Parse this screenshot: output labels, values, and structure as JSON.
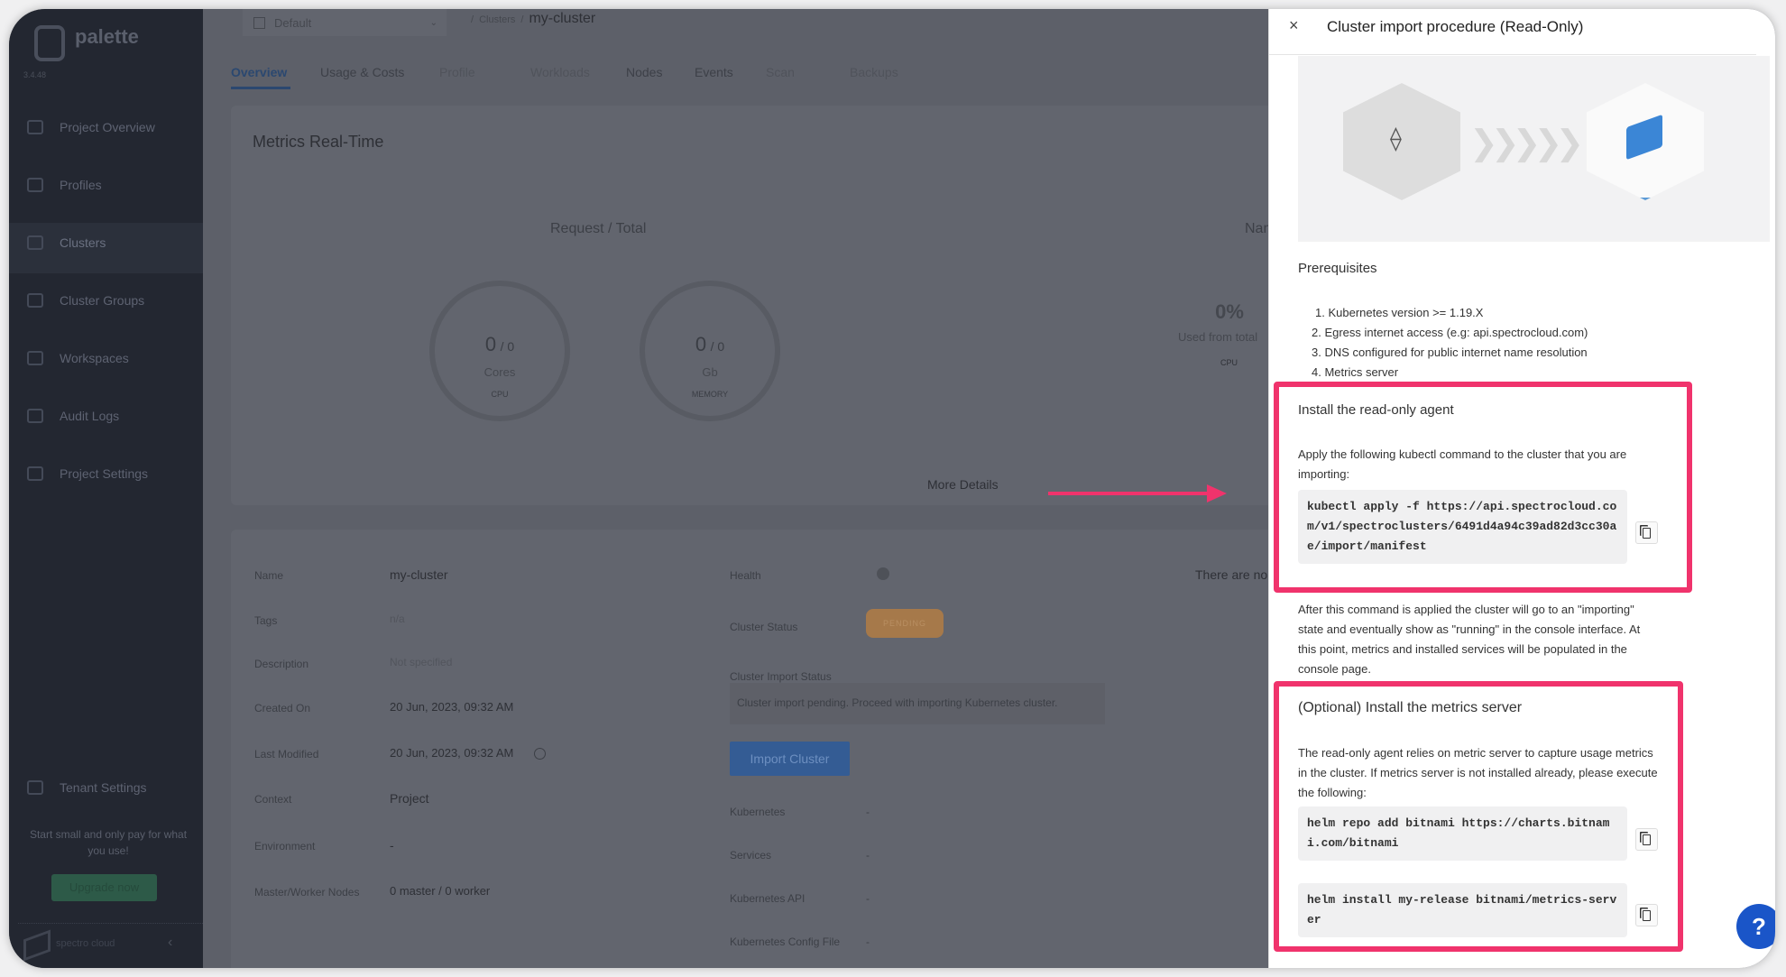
{
  "sidebar": {
    "brand": "palette",
    "version": "3.4.48",
    "items": [
      {
        "label": "Project Overview",
        "icon": "chart-icon"
      },
      {
        "label": "Profiles",
        "icon": "layers-icon"
      },
      {
        "label": "Clusters",
        "icon": "list-icon",
        "active": true
      },
      {
        "label": "Cluster Groups",
        "icon": "network-icon"
      },
      {
        "label": "Workspaces",
        "icon": "workspace-icon"
      },
      {
        "label": "Audit Logs",
        "icon": "document-icon"
      },
      {
        "label": "Project Settings",
        "icon": "gear-icon"
      }
    ],
    "tenant_settings": "Tenant Settings",
    "promo": "Start small and only pay for what you use!",
    "upgrade": "Upgrade now",
    "footer_brand": "spectro cloud"
  },
  "header": {
    "project": "Default",
    "breadcrumb_parent": "Clusters",
    "breadcrumb_current": "my-cluster",
    "tabs": [
      {
        "label": "Overview",
        "active": true
      },
      {
        "label": "Usage & Costs"
      },
      {
        "label": "Profile",
        "disabled": true
      },
      {
        "label": "Workloads",
        "disabled": true
      },
      {
        "label": "Nodes"
      },
      {
        "label": "Events"
      },
      {
        "label": "Scan",
        "disabled": true
      },
      {
        "label": "Backups",
        "disabled": true
      }
    ]
  },
  "metrics": {
    "title": "Metrics Real-Time",
    "request_total": "Request / Total",
    "gauges": [
      {
        "value": "0",
        "total": "/ 0",
        "unit": "Cores",
        "type": "CPU"
      },
      {
        "value": "0",
        "total": "/ 0",
        "unit": "Gb",
        "type": "MEMORY"
      }
    ],
    "namespace_label": "Nam",
    "percent": "0%",
    "used_from_total": "Used from total",
    "cpu": "CPU",
    "more_details": "More Details"
  },
  "details": {
    "left": [
      {
        "label": "Name",
        "value": "my-cluster"
      },
      {
        "label": "Tags",
        "value": "n/a"
      },
      {
        "label": "Description",
        "value": "Not specified"
      },
      {
        "label": "Created On",
        "value": "20 Jun, 2023, 09:32 AM"
      },
      {
        "label": "Last Modified",
        "value": "20 Jun, 2023, 09:32 AM"
      },
      {
        "label": "Context",
        "value": "Project"
      },
      {
        "label": "Environment",
        "value": "-"
      },
      {
        "label": "Master/Worker Nodes",
        "value": "0 master / 0 worker"
      }
    ],
    "health_label": "Health",
    "cluster_status_label": "Cluster Status",
    "cluster_status": "PENDING",
    "import_status_label": "Cluster Import Status",
    "import_status": "Cluster import pending. Proceed with importing Kubernetes cluster.",
    "import_button": "Import Cluster",
    "kubernetes_label": "Kubernetes",
    "services_label": "Services",
    "kubernetes_api_label": "Kubernetes API",
    "config_file_label": "Kubernetes Config File",
    "empty_value": "-",
    "right_partial": "There are no"
  },
  "drawer": {
    "title": "Cluster import procedure (Read-Only)",
    "prerequisites_title": "Prerequisites",
    "prerequisites": [
      "1. Kubernetes version >= 1.19.X",
      "2. Egress internet access (e.g: api.spectrocloud.com)",
      "3. DNS configured for public internet name resolution",
      "4. Metrics server"
    ],
    "agent_title": "Install the read-only agent",
    "agent_text": "Apply the following kubectl command to the cluster that you are importing:",
    "agent_command": "kubectl apply -f https://api.spectrocloud.com/v1/spectroclusters/6491d4a94c39ad82d3cc30ae/import/manifest",
    "after_text": "After this command is applied the cluster will go to an \"importing\" state and eventually show as \"running\" in the console interface. At this point, metrics and installed services will be populated in the console page.",
    "metrics_title": "(Optional) Install the metrics server",
    "metrics_text": "The read-only agent relies on metric server to capture usage metrics in the cluster. If metrics server is not installed already, please execute the following:",
    "helm_repo_command": "helm repo add bitnami https://charts.bitnami.com/bitnami",
    "helm_install_command": "helm install my-release bitnami/metrics-server"
  },
  "help": "?",
  "colors": {
    "highlight": "#f0336c",
    "primary": "#1f5fbf",
    "pending": "#a6794a",
    "upgrade": "#2d6a4f"
  }
}
